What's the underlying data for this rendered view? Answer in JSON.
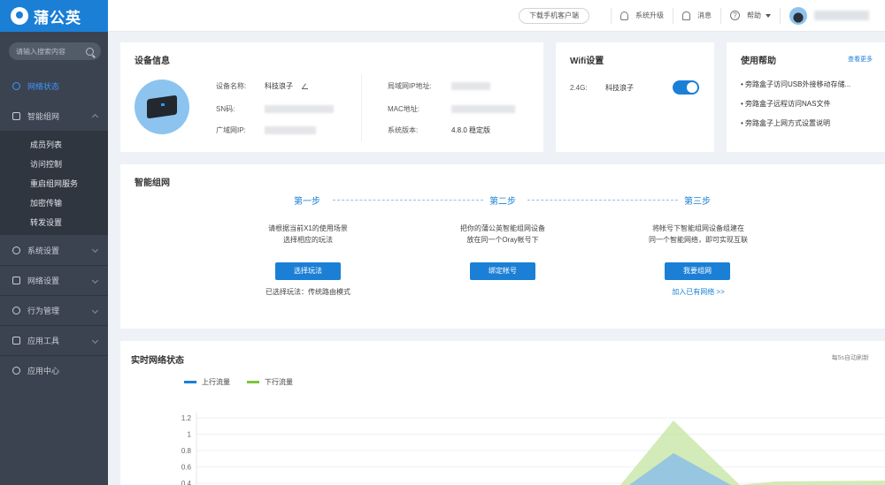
{
  "app": {
    "logo_text": "蒲公英"
  },
  "sidebar": {
    "search_placeholder": "请输入搜索内容",
    "items": [
      {
        "label": "网络状态",
        "active": true
      },
      {
        "label": "智能组网",
        "expanded": true
      },
      {
        "label": "系统设置"
      },
      {
        "label": "网络设置"
      },
      {
        "label": "行为管理"
      },
      {
        "label": "应用工具"
      },
      {
        "label": "应用中心"
      }
    ],
    "subitems": [
      "成员列表",
      "访问控制",
      "重启组网服务",
      "加密传输",
      "转发设置"
    ]
  },
  "header": {
    "download": "下载手机客户端",
    "upgrade": "系统升级",
    "messages": "消息",
    "help": "帮助"
  },
  "device": {
    "title": "设备信息",
    "name_label": "设备名称:",
    "name_value": "科技浪子",
    "sn_label": "SN码:",
    "wan_label": "广域网IP:",
    "lan_label": "局域网IP地址:",
    "mac_label": "MAC地址:",
    "version_label": "系统版本:",
    "version_value": "4.8.0 稳定版"
  },
  "wifi": {
    "title": "Wifi设置",
    "band": "2.4G:",
    "ssid": "科技浪子",
    "enabled": true
  },
  "help": {
    "title": "使用帮助",
    "more": "查看更多",
    "items": [
      "旁路盒子访问USB外接移动存储...",
      "旁路盒子远程访问NAS文件",
      "旁路盒子上网方式设置说明"
    ]
  },
  "network": {
    "title": "智能组网",
    "steps": [
      {
        "label": "第一步",
        "desc1": "请根据当前X1的使用场景",
        "desc2": "选择相应的玩法",
        "button": "选择玩法",
        "note": "已选择玩法：传统路由模式"
      },
      {
        "label": "第二步",
        "desc1": "把你的蒲公英智能组网设备",
        "desc2": "放在同一个Oray帐号下",
        "button": "绑定帐号",
        "note": ""
      },
      {
        "label": "第三步",
        "desc1": "将帐号下智能组网设备组建在",
        "desc2": "同一个智能网络，即可实现互联",
        "button": "我要组网",
        "note": "加入已有网络 >>"
      }
    ]
  },
  "realtime": {
    "title": "实时网络状态",
    "refresh": "每5s自动刷新"
  },
  "chart_data": {
    "type": "area",
    "series": [
      {
        "name": "上行流量",
        "color": "#1b7fd6"
      },
      {
        "name": "下行流量",
        "color": "#7dc63a"
      }
    ],
    "y_ticks": [
      "1.2",
      "1",
      "0.8",
      "0.6",
      "0.4"
    ],
    "ylim": [
      0.4,
      1.2
    ]
  }
}
